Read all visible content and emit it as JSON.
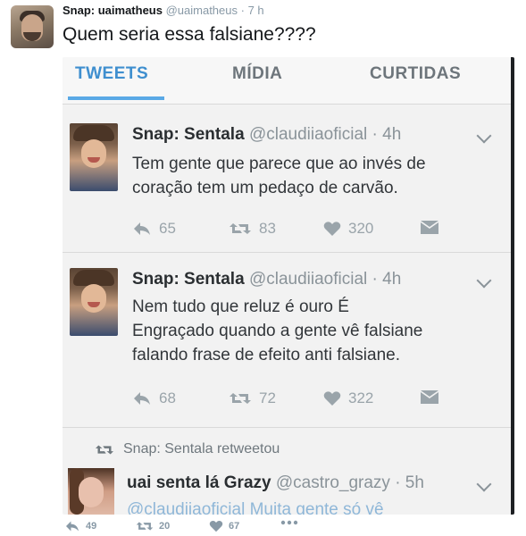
{
  "outer_tweet": {
    "name": "Snap: uaimatheus",
    "handle": "@uaimatheus",
    "dot": "·",
    "time": "7 h",
    "text": "Quem seria essa falsiane????",
    "counts": {
      "replies": "49",
      "retweets": "20",
      "likes": "67"
    }
  },
  "screenshot": {
    "tabs": [
      "TWEETS",
      "MÍDIA",
      "CURTIDAS"
    ],
    "tweets": [
      {
        "name": "Snap: Sentala",
        "handle": "@claudiiaoficial",
        "meta": "· 4h",
        "line1": "Tem gente que parece que ao invés de",
        "line2": "coração tem um pedaço de carvão.",
        "replies": "65",
        "retweets": "83",
        "likes": "320"
      },
      {
        "name": "Snap: Sentala",
        "handle": "@claudiiaoficial",
        "meta": "· 4h",
        "line1": "Nem tudo que reluz é ouro  É",
        "line2": "Engraçado quando a gente vê falsiane",
        "line3": "falando frase de efeito anti falsiane.",
        "replies": "68",
        "retweets": "72",
        "likes": "322"
      }
    ],
    "retweet_notice": "Snap: Sentala retweetou",
    "third": {
      "name": "uai senta lá Grazy",
      "handle": "@castro_grazy",
      "meta": "· 5h",
      "cut_text": "@claudiiaoficial Muita gente só vê"
    }
  },
  "colors": {
    "accent": "#3f8fcf",
    "muted": "#8899a6"
  },
  "icons": [
    "reply-icon",
    "retweet-icon",
    "heart-icon",
    "dm-icon",
    "chevron-down-icon"
  ]
}
